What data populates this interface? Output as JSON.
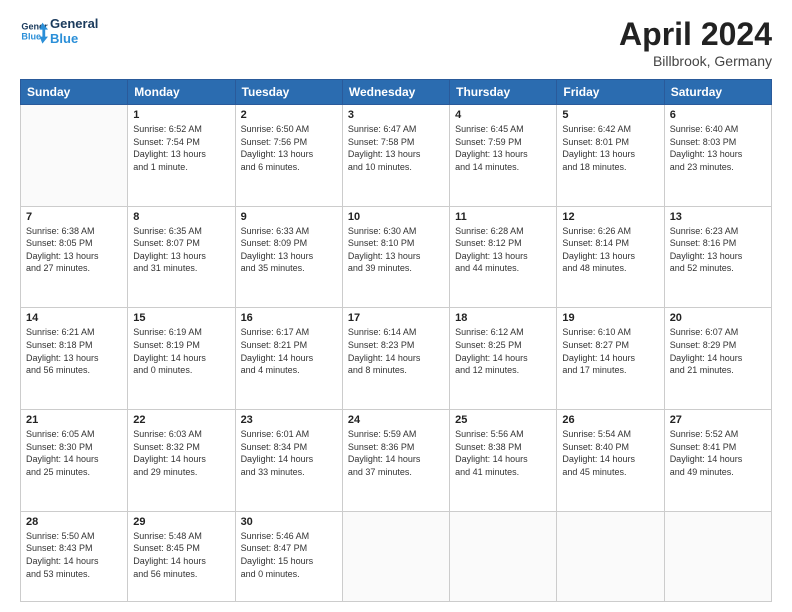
{
  "header": {
    "logo_line1": "General",
    "logo_line2": "Blue",
    "month": "April 2024",
    "location": "Billbrook, Germany"
  },
  "days_of_week": [
    "Sunday",
    "Monday",
    "Tuesday",
    "Wednesday",
    "Thursday",
    "Friday",
    "Saturday"
  ],
  "weeks": [
    [
      {
        "day": "",
        "info": ""
      },
      {
        "day": "1",
        "info": "Sunrise: 6:52 AM\nSunset: 7:54 PM\nDaylight: 13 hours\nand 1 minute."
      },
      {
        "day": "2",
        "info": "Sunrise: 6:50 AM\nSunset: 7:56 PM\nDaylight: 13 hours\nand 6 minutes."
      },
      {
        "day": "3",
        "info": "Sunrise: 6:47 AM\nSunset: 7:58 PM\nDaylight: 13 hours\nand 10 minutes."
      },
      {
        "day": "4",
        "info": "Sunrise: 6:45 AM\nSunset: 7:59 PM\nDaylight: 13 hours\nand 14 minutes."
      },
      {
        "day": "5",
        "info": "Sunrise: 6:42 AM\nSunset: 8:01 PM\nDaylight: 13 hours\nand 18 minutes."
      },
      {
        "day": "6",
        "info": "Sunrise: 6:40 AM\nSunset: 8:03 PM\nDaylight: 13 hours\nand 23 minutes."
      }
    ],
    [
      {
        "day": "7",
        "info": "Sunrise: 6:38 AM\nSunset: 8:05 PM\nDaylight: 13 hours\nand 27 minutes."
      },
      {
        "day": "8",
        "info": "Sunrise: 6:35 AM\nSunset: 8:07 PM\nDaylight: 13 hours\nand 31 minutes."
      },
      {
        "day": "9",
        "info": "Sunrise: 6:33 AM\nSunset: 8:09 PM\nDaylight: 13 hours\nand 35 minutes."
      },
      {
        "day": "10",
        "info": "Sunrise: 6:30 AM\nSunset: 8:10 PM\nDaylight: 13 hours\nand 39 minutes."
      },
      {
        "day": "11",
        "info": "Sunrise: 6:28 AM\nSunset: 8:12 PM\nDaylight: 13 hours\nand 44 minutes."
      },
      {
        "day": "12",
        "info": "Sunrise: 6:26 AM\nSunset: 8:14 PM\nDaylight: 13 hours\nand 48 minutes."
      },
      {
        "day": "13",
        "info": "Sunrise: 6:23 AM\nSunset: 8:16 PM\nDaylight: 13 hours\nand 52 minutes."
      }
    ],
    [
      {
        "day": "14",
        "info": "Sunrise: 6:21 AM\nSunset: 8:18 PM\nDaylight: 13 hours\nand 56 minutes."
      },
      {
        "day": "15",
        "info": "Sunrise: 6:19 AM\nSunset: 8:19 PM\nDaylight: 14 hours\nand 0 minutes."
      },
      {
        "day": "16",
        "info": "Sunrise: 6:17 AM\nSunset: 8:21 PM\nDaylight: 14 hours\nand 4 minutes."
      },
      {
        "day": "17",
        "info": "Sunrise: 6:14 AM\nSunset: 8:23 PM\nDaylight: 14 hours\nand 8 minutes."
      },
      {
        "day": "18",
        "info": "Sunrise: 6:12 AM\nSunset: 8:25 PM\nDaylight: 14 hours\nand 12 minutes."
      },
      {
        "day": "19",
        "info": "Sunrise: 6:10 AM\nSunset: 8:27 PM\nDaylight: 14 hours\nand 17 minutes."
      },
      {
        "day": "20",
        "info": "Sunrise: 6:07 AM\nSunset: 8:29 PM\nDaylight: 14 hours\nand 21 minutes."
      }
    ],
    [
      {
        "day": "21",
        "info": "Sunrise: 6:05 AM\nSunset: 8:30 PM\nDaylight: 14 hours\nand 25 minutes."
      },
      {
        "day": "22",
        "info": "Sunrise: 6:03 AM\nSunset: 8:32 PM\nDaylight: 14 hours\nand 29 minutes."
      },
      {
        "day": "23",
        "info": "Sunrise: 6:01 AM\nSunset: 8:34 PM\nDaylight: 14 hours\nand 33 minutes."
      },
      {
        "day": "24",
        "info": "Sunrise: 5:59 AM\nSunset: 8:36 PM\nDaylight: 14 hours\nand 37 minutes."
      },
      {
        "day": "25",
        "info": "Sunrise: 5:56 AM\nSunset: 8:38 PM\nDaylight: 14 hours\nand 41 minutes."
      },
      {
        "day": "26",
        "info": "Sunrise: 5:54 AM\nSunset: 8:40 PM\nDaylight: 14 hours\nand 45 minutes."
      },
      {
        "day": "27",
        "info": "Sunrise: 5:52 AM\nSunset: 8:41 PM\nDaylight: 14 hours\nand 49 minutes."
      }
    ],
    [
      {
        "day": "28",
        "info": "Sunrise: 5:50 AM\nSunset: 8:43 PM\nDaylight: 14 hours\nand 53 minutes."
      },
      {
        "day": "29",
        "info": "Sunrise: 5:48 AM\nSunset: 8:45 PM\nDaylight: 14 hours\nand 56 minutes."
      },
      {
        "day": "30",
        "info": "Sunrise: 5:46 AM\nSunset: 8:47 PM\nDaylight: 15 hours\nand 0 minutes."
      },
      {
        "day": "",
        "info": ""
      },
      {
        "day": "",
        "info": ""
      },
      {
        "day": "",
        "info": ""
      },
      {
        "day": "",
        "info": ""
      }
    ]
  ]
}
